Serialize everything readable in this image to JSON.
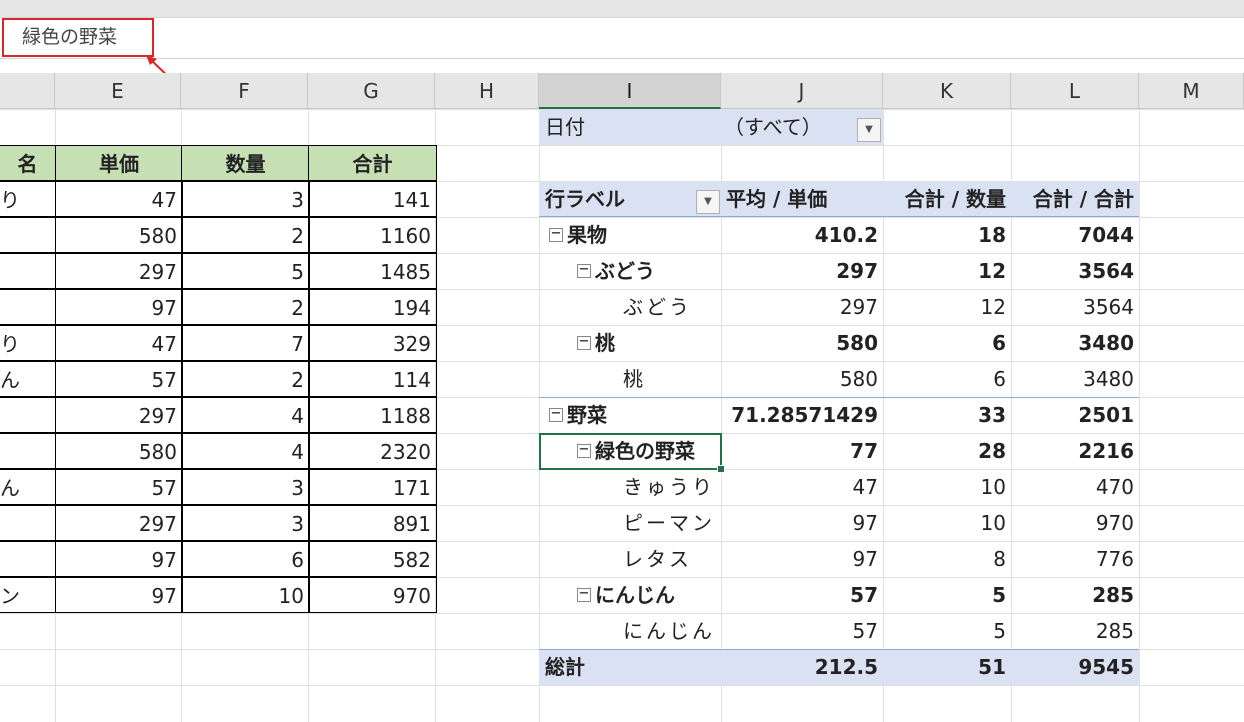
{
  "formula_bar": {
    "value": "緑色の野菜"
  },
  "columns": [
    "E",
    "F",
    "G",
    "H",
    "I",
    "J",
    "K",
    "L",
    "M"
  ],
  "source_table": {
    "headers": [
      "名",
      "単価",
      "数量",
      "合計"
    ],
    "rows": [
      [
        "り",
        "47",
        "3",
        "141"
      ],
      [
        "",
        "580",
        "2",
        "1160"
      ],
      [
        "",
        "297",
        "5",
        "1485"
      ],
      [
        "",
        "97",
        "2",
        "194"
      ],
      [
        "り",
        "47",
        "7",
        "329"
      ],
      [
        "ん",
        "57",
        "2",
        "114"
      ],
      [
        "",
        "297",
        "4",
        "1188"
      ],
      [
        "",
        "580",
        "4",
        "2320"
      ],
      [
        "ん",
        "57",
        "3",
        "171"
      ],
      [
        "",
        "297",
        "3",
        "891"
      ],
      [
        "",
        "97",
        "6",
        "582"
      ],
      [
        "ン",
        "97",
        "10",
        "970"
      ]
    ]
  },
  "pivot": {
    "filter_label": "日付",
    "filter_value": "（すべて）",
    "header": {
      "row_label": "行ラベル",
      "col1": "平均 / 単価",
      "col2": "合計 / 数量",
      "col3": "合計 / 合計"
    },
    "rows": [
      {
        "label": "果物",
        "level": 0,
        "bold": true,
        "toggle": true,
        "v1": "410.2",
        "v2": "18",
        "v3": "7044"
      },
      {
        "label": "ぶどう",
        "level": 1,
        "bold": true,
        "toggle": true,
        "v1": "297",
        "v2": "12",
        "v3": "3564"
      },
      {
        "label": "ぶどう",
        "level": 2,
        "bold": false,
        "toggle": false,
        "v1": "297",
        "v2": "12",
        "v3": "3564"
      },
      {
        "label": "桃",
        "level": 1,
        "bold": true,
        "toggle": true,
        "v1": "580",
        "v2": "6",
        "v3": "3480"
      },
      {
        "label": "桃",
        "level": 2,
        "bold": false,
        "toggle": false,
        "v1": "580",
        "v2": "6",
        "v3": "3480"
      },
      {
        "label": "野菜",
        "level": 0,
        "bold": true,
        "toggle": true,
        "v1": "71.28571429",
        "v2": "33",
        "v3": "2501"
      },
      {
        "label": "緑色の野菜",
        "level": 1,
        "bold": true,
        "toggle": true,
        "v1": "77",
        "v2": "28",
        "v3": "2216"
      },
      {
        "label": "きゅうり",
        "level": 2,
        "bold": false,
        "toggle": false,
        "v1": "47",
        "v2": "10",
        "v3": "470"
      },
      {
        "label": "ピーマン",
        "level": 2,
        "bold": false,
        "toggle": false,
        "v1": "97",
        "v2": "10",
        "v3": "970"
      },
      {
        "label": "レタス",
        "level": 2,
        "bold": false,
        "toggle": false,
        "v1": "97",
        "v2": "8",
        "v3": "776"
      },
      {
        "label": "にんじん",
        "level": 1,
        "bold": true,
        "toggle": true,
        "v1": "57",
        "v2": "5",
        "v3": "285"
      },
      {
        "label": "にんじん",
        "level": 2,
        "bold": false,
        "toggle": false,
        "v1": "57",
        "v2": "5",
        "v3": "285"
      }
    ],
    "total": {
      "label": "総計",
      "v1": "212.5",
      "v2": "51",
      "v3": "9545"
    }
  },
  "colors": {
    "pivot_header": "#d9e1f2",
    "source_header": "#c6e0b4",
    "selection": "#217346",
    "callout": "#d9262b"
  }
}
